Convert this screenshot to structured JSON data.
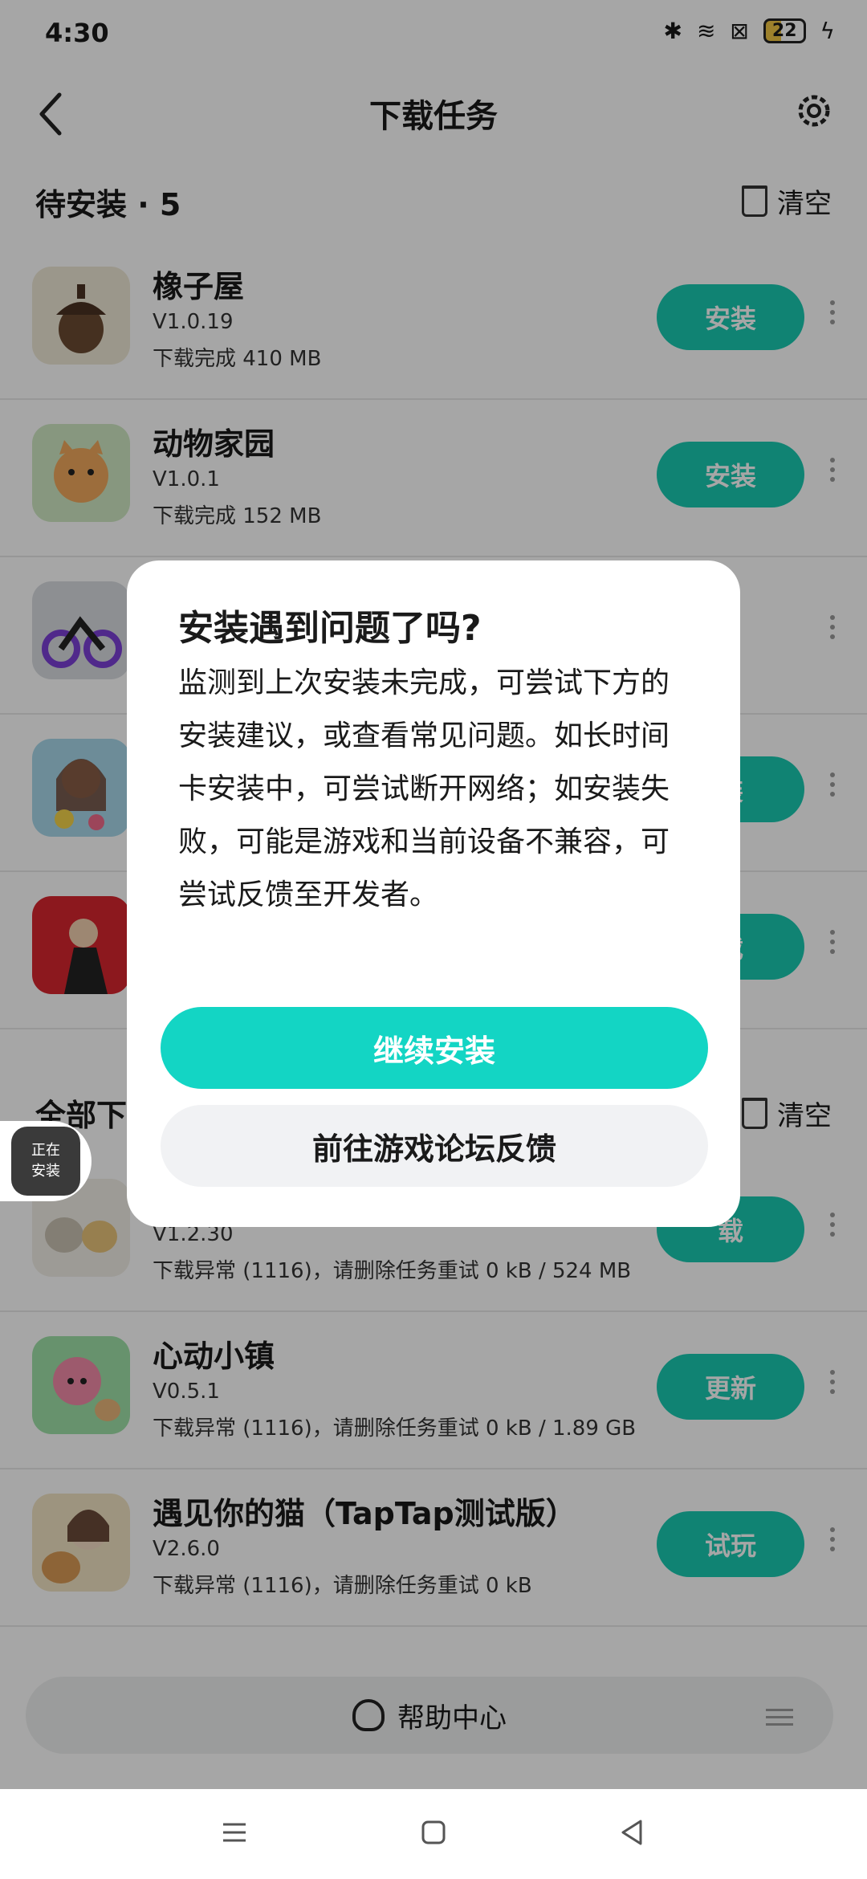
{
  "status_bar": {
    "time": "4:30",
    "battery": "22"
  },
  "header": {
    "title": "下载任务"
  },
  "pending": {
    "title": "待安装 · 5",
    "clear_label": "清空",
    "items": [
      {
        "name": "橡子屋",
        "version": "V1.0.19",
        "status": "下载完成  410 MB",
        "button": "安装"
      },
      {
        "name": "动物家园",
        "version": "V1.0.1",
        "status": "下载完成  152 MB",
        "button": "安装"
      },
      {
        "name": "",
        "version": "",
        "status": "",
        "button": ""
      },
      {
        "name": "",
        "version": "",
        "status": "",
        "button": "装"
      },
      {
        "name": "",
        "version": "",
        "status": "",
        "button": "载"
      }
    ]
  },
  "all": {
    "title": "全部下",
    "clear_label": "清空",
    "items": [
      {
        "name": "",
        "version": "V1.2.30",
        "status": "下载异常 (1116)，请删除任务重试  0 kB / 524 MB",
        "button": "载"
      },
      {
        "name": "心动小镇",
        "version": "V0.5.1",
        "status": "下载异常 (1116)，请删除任务重试  0 kB / 1.89 GB",
        "button": "更新"
      },
      {
        "name": "遇见你的猫（TapTap测试版）",
        "version": "V2.6.0",
        "status": "下载异常 (1116)，请删除任务重试  0 kB",
        "button": "试玩"
      }
    ]
  },
  "floating": {
    "line1": "正在",
    "line2": "安装"
  },
  "dialog": {
    "title": "安装遇到问题了吗?",
    "body": "监测到上次安装未完成，可尝试下方的安装建议，或查看常见问题。如长时间卡安装中，可尝试断开网络；如安装失败，可能是游戏和当前设备不兼容，可尝试反馈至开发者。",
    "primary": "继续安装",
    "secondary": "前往游戏论坛反馈"
  },
  "help": {
    "label": "帮助中心"
  }
}
